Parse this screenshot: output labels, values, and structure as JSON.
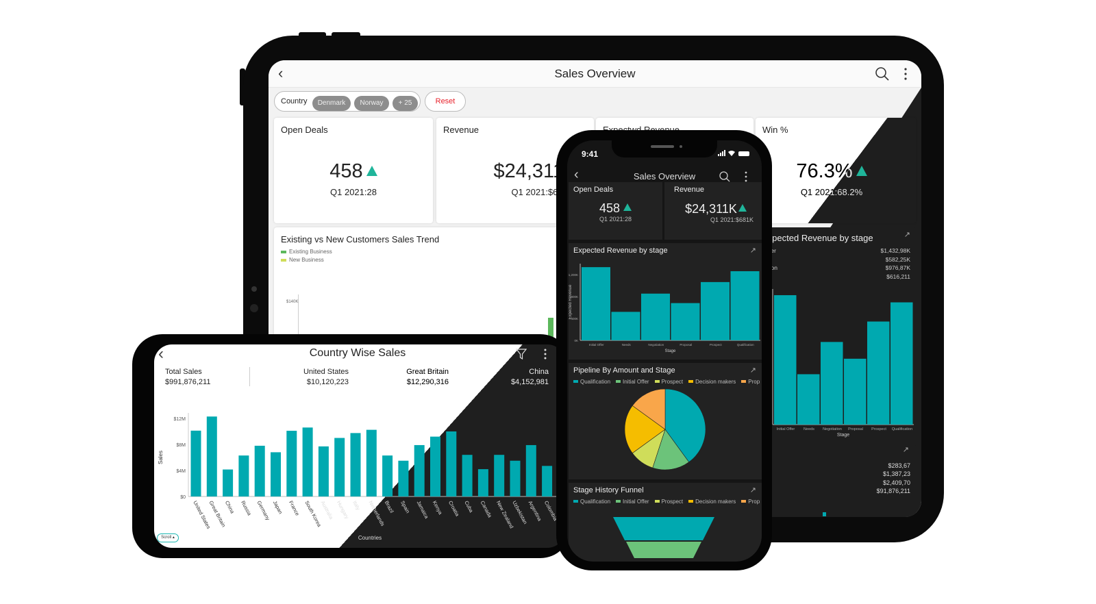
{
  "colors": {
    "teal": "#00a9b0",
    "up": "#1fb59a",
    "green": "#6cc37a",
    "lime": "#cfdd5a",
    "yellow": "#f5bd00",
    "orange": "#f9a64a",
    "reset": "#e8202a"
  },
  "tablet": {
    "title": "Sales Overview",
    "icons": {
      "back": "chevron-left-icon",
      "search": "search-icon",
      "more": "more-vertical-icon"
    },
    "filter": {
      "label": "Country",
      "chips": [
        "Denmark",
        "Norway",
        "+ 25"
      ],
      "reset": "Reset"
    },
    "kpis": [
      {
        "title": "Open Deals",
        "value": "458",
        "sub": "Q1 2021:28",
        "trend": "up"
      },
      {
        "title": "Revenue",
        "value": "$24,311K",
        "sub": "Q1 2021:$681K",
        "trend": "up"
      },
      {
        "title": "Expectwd Revenue"
      },
      {
        "title": "Win %",
        "value": "76.3%",
        "sub": "Q1 2021:68.2%",
        "trend": "up"
      }
    ],
    "trend_chart": {
      "title": "Existing vs New Customers Sales Trend",
      "legend": [
        "Existing Business",
        "New Business"
      ],
      "ytick": "$140K"
    },
    "stage_card": {
      "title": "Expected Revenue by stage",
      "rows": [
        {
          "label": "Initial Offer",
          "value": "$1,432,98K"
        },
        {
          "label": "Needs",
          "value": "$582,25K"
        },
        {
          "label": "Negotiation",
          "value": "$976,87K"
        },
        {
          "label": "Proposal",
          "value": "$616,211"
        }
      ],
      "xlabel": "Stage"
    },
    "bottom_card": {
      "values": [
        "$283,67",
        "$1,387,23",
        "$2,409,70",
        "$91,876,211"
      ]
    }
  },
  "phone": {
    "time": "9:41",
    "title": "Sales Overview",
    "kpis": [
      {
        "title": "Open Deals",
        "value": "458",
        "sub": "Q1 2021:28",
        "trend": "up"
      },
      {
        "title": "Revenue",
        "value": "$24,311K",
        "sub": "Q1 2021:$681K",
        "trend": "up"
      }
    ],
    "pipeline": {
      "title": "Pipeline By Amount and Stage",
      "legend": [
        "Qualification",
        "Initial Offer",
        "Prospect",
        "Decision makers",
        "Prop"
      ]
    },
    "funnel": {
      "title": "Stage History Funnel",
      "legend": [
        "Qualification",
        "Initial Offer",
        "Prospect",
        "Decision makers",
        "Prop"
      ]
    }
  },
  "landscape": {
    "title": "Country Wise Sales",
    "icons": {
      "back": "chevron-left-icon",
      "filter": "filter-icon",
      "more": "more-vertical-icon"
    },
    "stats": [
      {
        "label": "Total Sales",
        "value": "$991,876,211"
      },
      {
        "label": "United States",
        "value": "$10,120,223"
      },
      {
        "label": "Great Britain",
        "value": "$12,290,316"
      },
      {
        "label": "China",
        "value": "$4,152,981"
      }
    ],
    "scroll": "Scroll"
  },
  "chart_data": [
    {
      "type": "bar",
      "title": "Expected Revenue by stage",
      "xlabel": "Stage",
      "ylabel": "Expected Revenue",
      "categories": [
        "Initial Offer",
        "Needs",
        "Negotiation",
        "Proposal",
        "Prospect",
        "Qualification"
      ],
      "values": [
        1336,
        520,
        853,
        680,
        1064,
        1262
      ],
      "unit": "K",
      "yticks": [
        "0K",
        "400K",
        "800K",
        "1,200K"
      ],
      "ylim": [
        0,
        1400
      ]
    },
    {
      "type": "pie",
      "title": "Pipeline By Amount and Stage",
      "categories": [
        "Qualification",
        "Initial Offer",
        "Prospect",
        "Decision makers",
        "Proposal"
      ],
      "values": [
        40,
        15,
        10,
        20,
        15
      ]
    },
    {
      "type": "bar",
      "title": "Country Wise Sales",
      "xlabel": "Countries",
      "ylabel": "Sales",
      "yticks": [
        "$0",
        "$4M",
        "$8M",
        "$12M"
      ],
      "ylim": [
        0,
        13
      ],
      "unit": "M",
      "categories": [
        "United States",
        "Great Britain",
        "China",
        "Russia",
        "Germany",
        "Japan",
        "France",
        "South Korea",
        "Australia",
        "Hungary",
        "Italy",
        "Netherlands",
        "Brazil",
        "Spain",
        "Jamaica",
        "Kenya",
        "Croatia",
        "Cuba",
        "Canada",
        "New Zealand",
        "Uzbekistan",
        "Argentina",
        "Colombia"
      ],
      "values": [
        10.12,
        12.29,
        4.15,
        6.3,
        7.8,
        6.8,
        10.1,
        10.6,
        7.7,
        9.0,
        9.75,
        10.25,
        6.3,
        5.5,
        7.9,
        9.2,
        10.0,
        6.4,
        4.2,
        6.4,
        5.5,
        7.9,
        4.7
      ]
    },
    {
      "type": "funnel",
      "title": "Stage History Funnel",
      "categories": [
        "Qualification",
        "Initial Offer"
      ]
    }
  ]
}
